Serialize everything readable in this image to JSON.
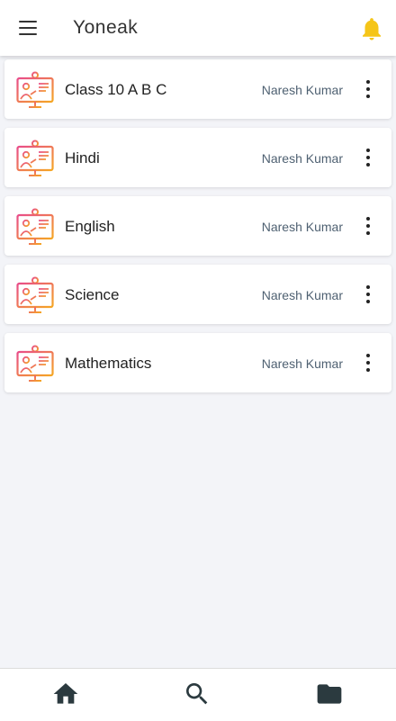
{
  "app": {
    "title": "Yoneak",
    "accent_color": "#f5c518"
  },
  "header": {
    "menu_icon": "menu-icon",
    "notification_icon": "bell-icon"
  },
  "classes": [
    {
      "name": "Class 10 A B C",
      "teacher": "Naresh Kumar",
      "icon": "teacher-board-icon",
      "more_icon": "more-vertical-icon"
    },
    {
      "name": "Hindi",
      "teacher": "Naresh Kumar",
      "icon": "teacher-board-icon",
      "more_icon": "more-vertical-icon"
    },
    {
      "name": "English",
      "teacher": "Naresh Kumar",
      "icon": "teacher-board-icon",
      "more_icon": "more-vertical-icon"
    },
    {
      "name": "Science",
      "teacher": "Naresh Kumar",
      "icon": "teacher-board-icon",
      "more_icon": "more-vertical-icon"
    },
    {
      "name": "Mathematics",
      "teacher": "Naresh Kumar",
      "icon": "teacher-board-icon",
      "more_icon": "more-vertical-icon"
    }
  ],
  "bottom_nav": [
    {
      "icon": "home-icon"
    },
    {
      "icon": "search-icon"
    },
    {
      "icon": "folder-icon"
    }
  ]
}
